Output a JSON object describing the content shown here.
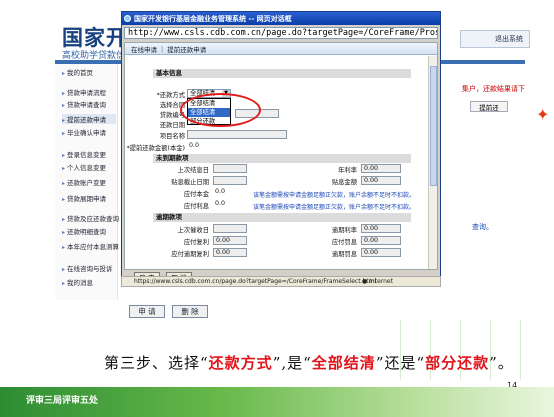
{
  "background_page": {
    "title": "国家开发",
    "subtitle": "高校助学贷款信",
    "top_right_button": "退出系统",
    "sidebar_items": [
      {
        "label": "我的首页",
        "active": false
      },
      {
        "label": "贷款申请流程",
        "active": false
      },
      {
        "label": "贷款申请查询",
        "active": false
      },
      {
        "label": "提前还款申请",
        "active": true
      },
      {
        "label": "毕业确认申请",
        "active": false
      },
      {
        "label": "登录信息变更",
        "active": false
      },
      {
        "label": "个人信息变更",
        "active": false
      },
      {
        "label": "还款账户变更",
        "active": false
      },
      {
        "label": "贷款展期申请",
        "active": false
      },
      {
        "label": "贷款及应还款查询",
        "active": false
      },
      {
        "label": "还款明细查询",
        "active": false
      },
      {
        "label": "本年应付本息测算",
        "active": false
      },
      {
        "label": "在线咨询与投诉",
        "active": false
      },
      {
        "label": "我的消息",
        "active": false
      }
    ],
    "right_notice": "集户，还款结果请下",
    "right_button": "提前还",
    "right_query": "查询。",
    "bottom_buttons": [
      "申 请",
      "删 除"
    ]
  },
  "dialog": {
    "title": "国家开发银行基层金融业务管理系统 -- 网页对话框",
    "address": "http://www.csls.cdb.com.cn/page.do?targetPage=/CoreFrame/Pros",
    "tabs": [
      "在线申请",
      "提前还款申请"
    ],
    "sections": {
      "basic": "基本信息",
      "unpaid": "未到期款项",
      "overdue": "逾期款项"
    },
    "fields": {
      "repay_method_label": "*还款方式",
      "repay_method_value": "全部结清",
      "select_label": "选择合同",
      "contract_no_label": "贷款编号",
      "repay_date_label": "还款日期",
      "repay_date_value": "2015-04-20",
      "project_name_label": "项目名称",
      "prepay_amount_label": "*提前还款金额(本金)",
      "prepay_amount_value": "0.0",
      "last_end_date_label": "上次结息日",
      "annual_rate_label": "年利率",
      "annual_rate_value": "0.00",
      "interest_end_date_label": "贴息截止日期",
      "interest_amount_label": "贴息金额",
      "interest_amount_value": "0.00",
      "payable_principal_label": "应付本金",
      "payable_principal_value": "0.0",
      "payable_interest_label": "应付利息",
      "payable_interest_value": "0.0",
      "last_collect_date_label": "上次催收日",
      "overdue_rate_label": "逾期利率",
      "overdue_rate_value": "0.00",
      "payable_compound_label": "应付复利",
      "payable_compound_value": "0.00",
      "payable_penalty_label": "应付罚息",
      "payable_penalty_value": "0.00",
      "overdue_compound_label": "应付逾期复利",
      "overdue_compound_value": "0.00",
      "overdue_penalty_label": "逾期罚息",
      "overdue_penalty_value": "0.00"
    },
    "notes": {
      "principal": "该笔金额需按申请金额足额正欠款，账户余额不足时不扣款。",
      "interest": "该笔金额需按申请金额足额正欠款，账户余额不足时不扣款。"
    },
    "dropdown_options": [
      {
        "label": "全部结清",
        "selected": false
      },
      {
        "label": "全部结清",
        "selected": true
      },
      {
        "label": "部分还款",
        "selected": false
      }
    ],
    "buttons": {
      "confirm": "确 定",
      "cancel": "取 消"
    },
    "status_url": "https://www.csls.cdb.com.cn/page.do?targetPage=/CoreFrame/FrameSelect.html",
    "status_zone": "Internet"
  },
  "caption": {
    "part1": "第三步、选择“",
    "highlight1": "还款方式",
    "part2": "”,是“",
    "highlight2": "全部结清",
    "part3": "”还是“",
    "highlight3": "部分还款",
    "part4": "”。"
  },
  "page_number": "14",
  "footer_text": "评审三局评审五处",
  "colors": {
    "highlight": "#e0141b",
    "title_blue": "#17407f",
    "footer_green": "#2d8c33",
    "oval": "#e21b1b"
  }
}
